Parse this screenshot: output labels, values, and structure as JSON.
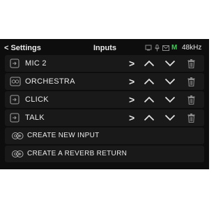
{
  "header": {
    "back_label": "Settings",
    "title": "Inputs",
    "status_m": "M",
    "sample_rate": "48kHz"
  },
  "inputs": [
    {
      "name": "MIC 2",
      "icon": "input-jack-icon"
    },
    {
      "name": "ORCHESTRA",
      "icon": "stereo-input-icon"
    },
    {
      "name": "CLICK",
      "icon": "input-jack-icon"
    },
    {
      "name": "TALK",
      "icon": "input-jack-icon"
    }
  ],
  "row_controls": {
    "open": ">"
  },
  "actions": {
    "create_input": "CREATE NEW INPUT",
    "create_reverb": "CREATE A REVERB RETURN"
  },
  "colors": {
    "background": "#0d0d0d",
    "row": "#191919",
    "icon": "#9a9a9a",
    "status_green": "#2fd34a"
  }
}
